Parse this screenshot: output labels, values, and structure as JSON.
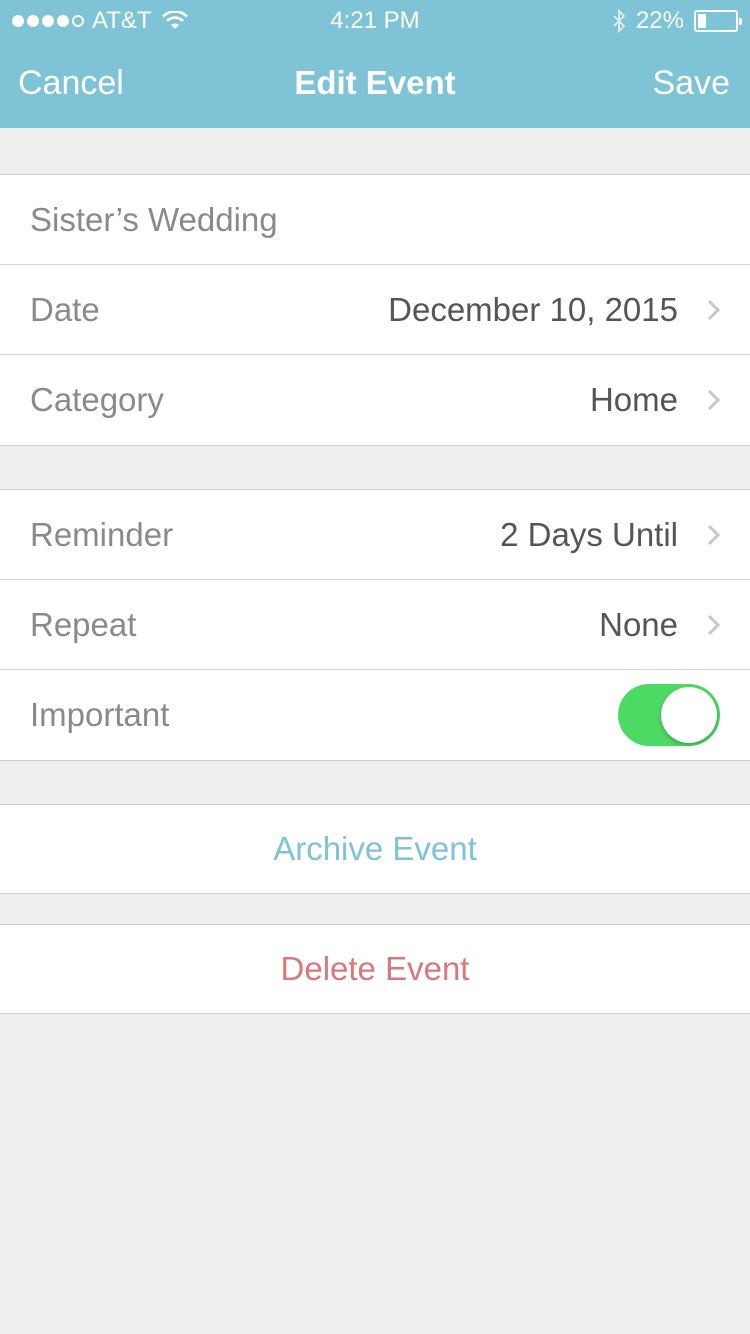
{
  "status_bar": {
    "carrier": "AT&T",
    "time": "4:21 PM",
    "battery_percent": "22%",
    "battery_level": 0.22,
    "signal_bars": 4,
    "signal_total": 5
  },
  "nav": {
    "cancel_label": "Cancel",
    "title": "Edit Event",
    "save_label": "Save"
  },
  "event": {
    "title": "Sister’s Wedding",
    "date_label": "Date",
    "date_value": "December 10, 2015",
    "category_label": "Category",
    "category_value": "Home"
  },
  "settings": {
    "reminder_label": "Reminder",
    "reminder_value": "2 Days Until",
    "repeat_label": "Repeat",
    "repeat_value": "None",
    "important_label": "Important",
    "important_on": true
  },
  "actions": {
    "archive_label": "Archive Event",
    "delete_label": "Delete Event"
  },
  "colors": {
    "accent": "#7ec3d6",
    "archive": "#7ec3d6",
    "delete": "#d9787b",
    "toggle_on": "#4cd964",
    "background": "#efefef"
  },
  "icons": [
    "wifi-icon",
    "bluetooth-icon",
    "battery-icon",
    "chevron-right-icon"
  ]
}
